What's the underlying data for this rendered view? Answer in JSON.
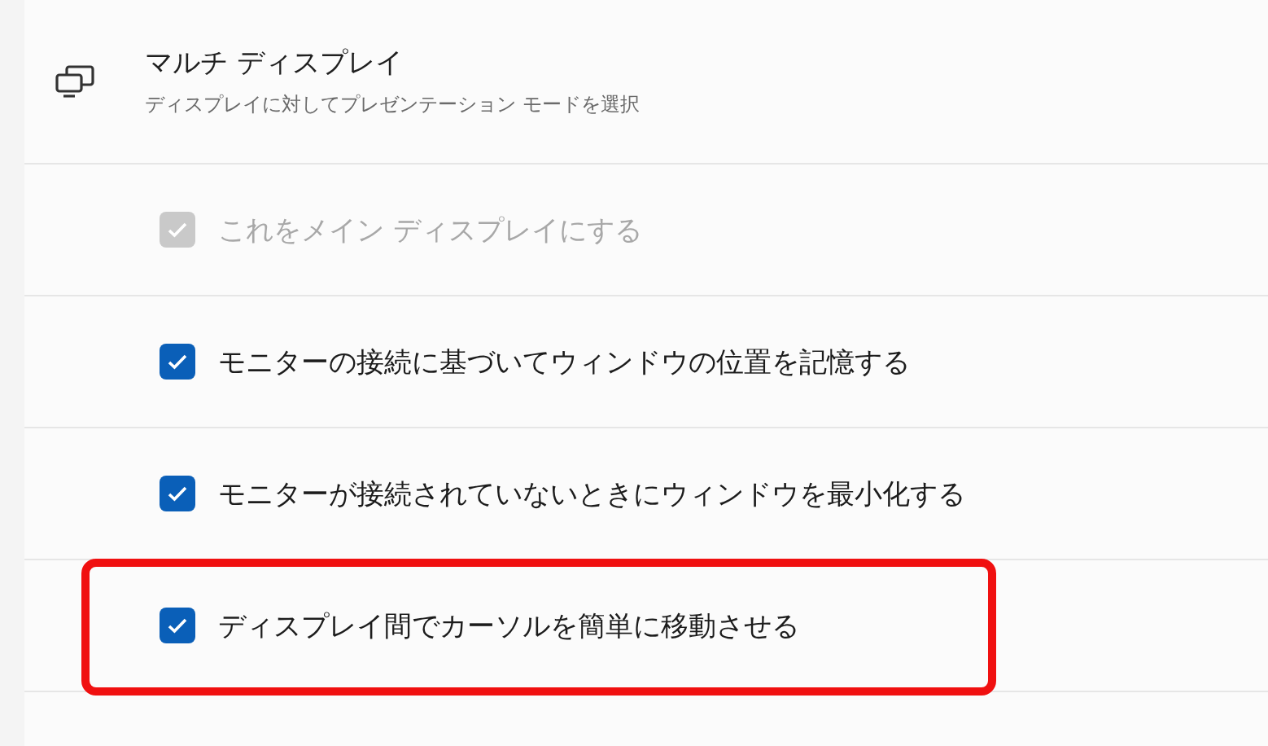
{
  "section": {
    "title": "マルチ ディスプレイ",
    "subtitle": "ディスプレイに対してプレゼンテーション モードを選択"
  },
  "options": [
    {
      "label": "これをメイン ディスプレイにする",
      "checked": true,
      "disabled": true,
      "highlighted": false
    },
    {
      "label": "モニターの接続に基づいてウィンドウの位置を記憶する",
      "checked": true,
      "disabled": false,
      "highlighted": false
    },
    {
      "label": "モニターが接続されていないときにウィンドウを最小化する",
      "checked": true,
      "disabled": false,
      "highlighted": false
    },
    {
      "label": "ディスプレイ間でカーソルを簡単に移動させる",
      "checked": true,
      "disabled": false,
      "highlighted": true
    }
  ]
}
